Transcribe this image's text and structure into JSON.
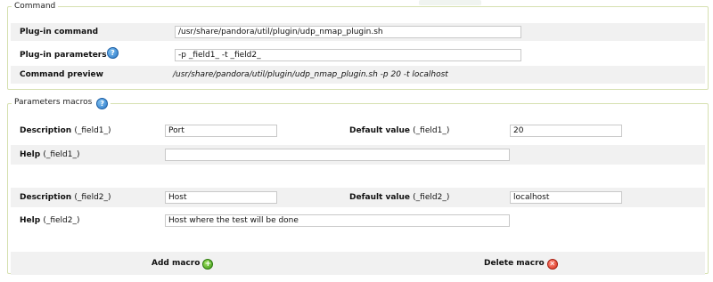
{
  "command": {
    "legend": "Command",
    "plugin_command_label": "Plug-in command",
    "plugin_command_value": "/usr/share/pandora/util/plugin/udp_nmap_plugin.sh",
    "plugin_parameters_label": "Plug-in parameters",
    "plugin_parameters_value": "-p _field1_ -t _field2_",
    "preview_label": "Command preview",
    "preview_value": "/usr/share/pandora/util/plugin/udp_nmap_plugin.sh -p 20 -t localhost"
  },
  "macros": {
    "legend": "Parameters macros",
    "field1": {
      "description_label": "Description",
      "description_suffix": "(_field1_)",
      "description_value": "Port",
      "default_label": "Default value",
      "default_suffix": "(_field1_)",
      "default_value": "20",
      "help_label": "Help",
      "help_suffix": "(_field1_)",
      "help_value": ""
    },
    "field2": {
      "description_label": "Description",
      "description_suffix": "(_field2_)",
      "description_value": "Host",
      "default_label": "Default value",
      "default_suffix": "(_field2_)",
      "default_value": "localhost",
      "help_label": "Help",
      "help_suffix": "(_field2_)",
      "help_value": "Host where the test will be done"
    },
    "add_macro_label": "Add macro",
    "delete_macro_label": "Delete macro"
  },
  "icons": {
    "help": "help-icon",
    "add": "add-icon",
    "delete": "delete-icon"
  }
}
